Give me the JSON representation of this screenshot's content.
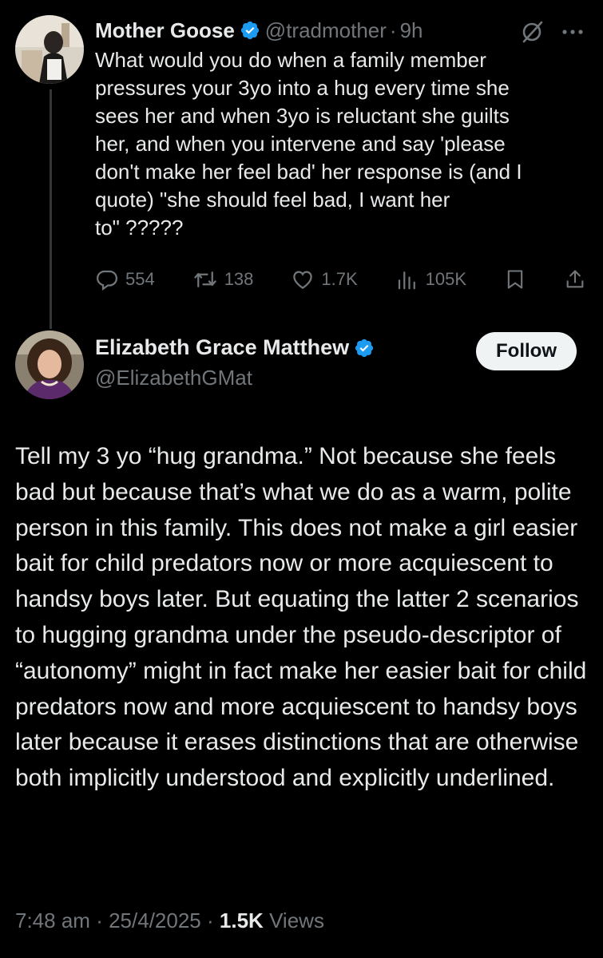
{
  "tweet1": {
    "name": "Mother Goose",
    "handle": "@tradmother",
    "separator": "·",
    "time": "9h",
    "text": "What would you do when a family member\npressures your 3yo into a hug every time she\nsees her and when 3yo is reluctant she guilts\nher, and when you intervene and say 'please\ndon't make her feel bad' her response is (and I\nquote) \"she should feel bad, I want her\nto\" ?????",
    "stats": {
      "replies": "554",
      "retweets": "138",
      "likes": "1.7K",
      "views": "105K"
    },
    "icons": [
      "grok-icon",
      "more-icon",
      "reply-icon",
      "retweet-icon",
      "like-icon",
      "views-icon",
      "bookmark-icon",
      "share-icon"
    ]
  },
  "tweet2": {
    "name": "Elizabeth Grace Matthew",
    "handle": "@ElizabethGMat",
    "follow_label": "Follow",
    "text": "Tell my 3 yo “hug grandma.” Not because she feels bad but because that’s what we do as a warm, polite person in this family. This does not make a girl easier bait for child predators now or more acquiescent to handsy boys later. But equating the latter 2 scenarios to hugging grandma under the pseudo-descriptor of “autonomy” might in fact make her easier bait for child predators now and more acquiescent to handsy boys later because it erases distinctions that are otherwise both implicitly understood and explicitly underlined.",
    "timestamp": "7:48 am",
    "date": "25/4/2025",
    "separator": "·",
    "views_count": "1.5K",
    "views_label": "Views"
  },
  "colors": {
    "background": "#000000",
    "text": "#e7e9ea",
    "secondary": "#71767b",
    "verified": "#1d9bf0",
    "follow_bg": "#eff3f4"
  }
}
